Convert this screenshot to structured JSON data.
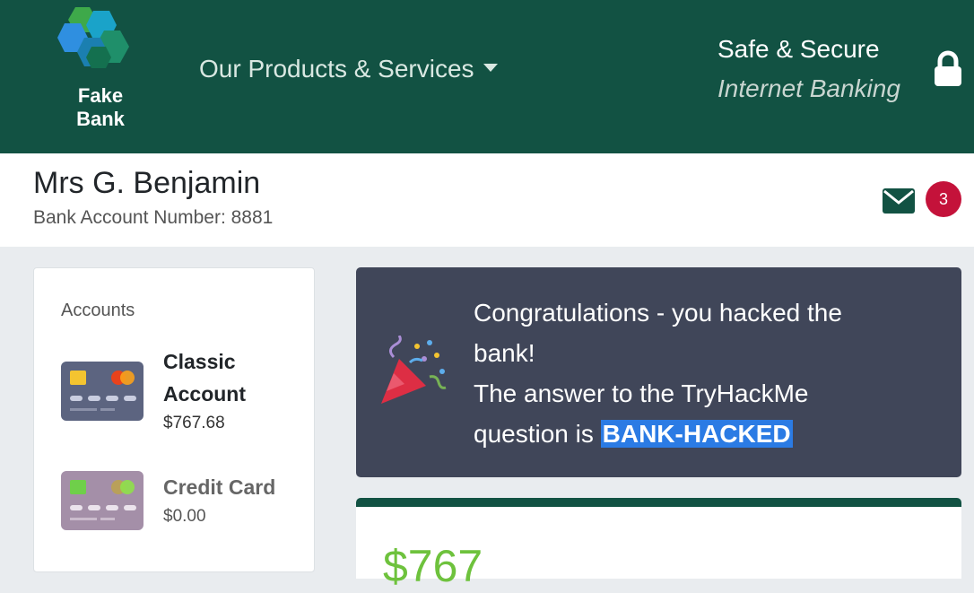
{
  "header": {
    "logo_line1": "Fake",
    "logo_line2": "Bank",
    "products_label": "Our Products & Services",
    "safe_label": "Safe & Secure",
    "banking_label": "Internet Banking",
    "lock_icon": "lock-icon"
  },
  "user": {
    "name": "Mrs G. Benjamin",
    "account_number": "Bank Account Number: 8881",
    "mail_icon": "envelope-icon",
    "notification_count": "3"
  },
  "accounts": {
    "heading": "Accounts",
    "items": [
      {
        "name": "Classic Account",
        "balance": "$767.68",
        "icon": "card-icon"
      },
      {
        "name": "Credit Card",
        "balance": "$0.00",
        "icon": "card-icon"
      }
    ]
  },
  "message": {
    "line1": "Congratulations - you hacked the bank!",
    "line2_prefix": "The answer to the TryHackMe question is ",
    "answer": "BANK-HACKED",
    "icon": "party-popper-icon"
  },
  "balance_card": {
    "amount": "$767"
  },
  "colors": {
    "brand_green": "#125243",
    "badge_red": "#c4123a",
    "message_bg": "#404659",
    "balance_green": "#6ec23d",
    "highlight_blue": "#2b7be4"
  }
}
